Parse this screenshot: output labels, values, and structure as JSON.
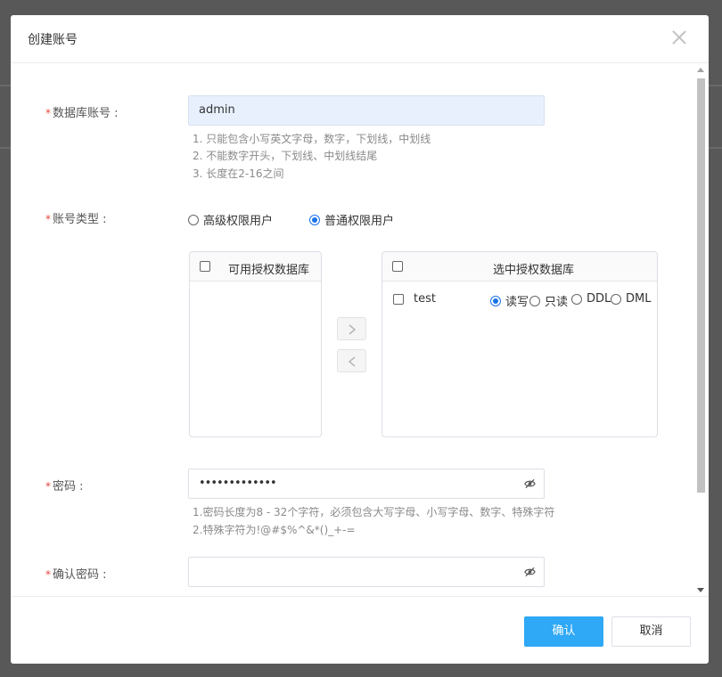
{
  "dialog": {
    "title": "创建账号",
    "fields": {
      "db_account": {
        "required_mark": "*",
        "label": "数据库账号 :",
        "value": "admin",
        "hints": [
          "1. 只能包含小写英文字母，数字，下划线，中划线",
          "2. 不能数字开头，下划线、中划线结尾",
          "3. 长度在2-16之间"
        ]
      },
      "account_type": {
        "required_mark": "*",
        "label": "账号类型 :",
        "options": [
          {
            "label": "高级权限用户",
            "selected": false
          },
          {
            "label": "普通权限用户",
            "selected": true
          }
        ]
      },
      "password": {
        "required_mark": "*",
        "label": "密码 :",
        "value": "•••••••••••••",
        "hints": [
          "1.密码长度为8 - 32个字符，必须包含大写字母、小写字母、数字、特殊字符",
          "2.特殊字符为!@#$%^&*()_+-="
        ]
      },
      "confirm_password": {
        "required_mark": "*",
        "label": "确认密码 :",
        "value": ""
      }
    },
    "transfer": {
      "left_title": "可用授权数据库",
      "right_title": "选中授权数据库",
      "right_items": [
        {
          "name": "test",
          "permissions": [
            {
              "label": "读写",
              "selected": true
            },
            {
              "label": "只读",
              "selected": false
            },
            {
              "label": "DDL",
              "selected": false
            },
            {
              "label": "DML",
              "selected": false
            }
          ]
        }
      ]
    },
    "footer": {
      "confirm_label": "确认",
      "cancel_label": "取消"
    }
  },
  "colors": {
    "primary": "#2fa8f6",
    "required": "#e5473b",
    "radio_active": "#1a73e8",
    "input_autofill_bg": "#e8f0fe"
  },
  "icons": {
    "close": "close-icon",
    "eye": "eye-slash-icon",
    "move_right": "chevron-right-icon",
    "move_left": "chevron-left-icon"
  }
}
